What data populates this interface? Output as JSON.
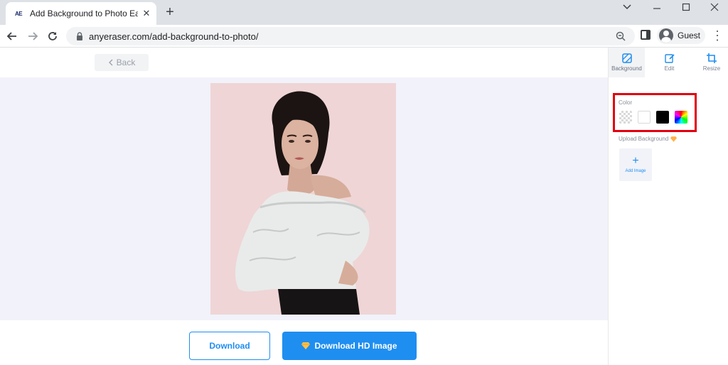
{
  "browser": {
    "tab": {
      "favicon": "AE",
      "title": "Add Background to Photo Easily",
      "close_icon": "close-icon"
    },
    "new_tab_icon": "plus-icon",
    "window_controls": [
      "chevron-down-icon",
      "minimize-icon",
      "maximize-icon",
      "close-icon"
    ],
    "url": "anyeraser.com/add-background-to-photo/",
    "profile": "Guest"
  },
  "app": {
    "back_label": "Back",
    "tabs": [
      {
        "label": "Background",
        "icon": "background-icon",
        "active": true
      },
      {
        "label": "Edit",
        "icon": "edit-icon",
        "active": false
      },
      {
        "label": "Resize",
        "icon": "crop-icon",
        "active": false
      }
    ],
    "color_label": "Color",
    "swatches": [
      {
        "name": "transparent",
        "color": "transparent"
      },
      {
        "name": "white",
        "color": "#ffffff"
      },
      {
        "name": "black",
        "color": "#000000"
      },
      {
        "name": "custom",
        "color": "rainbow"
      }
    ],
    "upload_label": "Upload Background",
    "add_image_label": "Add Image",
    "download_label": "Download",
    "download_hd_label": "Download HD Image",
    "photo_background": "#efd5d6",
    "accent": "#1f8ef1",
    "highlight_color": "#e3000f"
  }
}
